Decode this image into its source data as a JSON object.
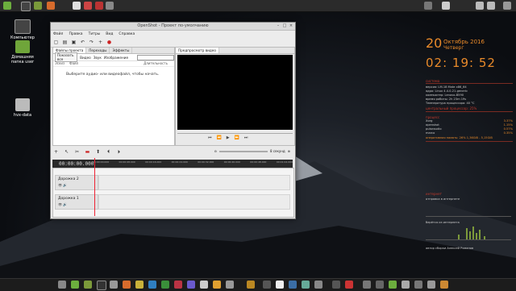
{
  "desktop": {
    "icons": [
      {
        "label": "Компьютер"
      },
      {
        "label": "Домашняя папка user"
      },
      {
        "label": "hvx-data"
      }
    ]
  },
  "window": {
    "title": "OpenShot - Проект по-умолчанию",
    "menu": [
      "Файл",
      "Правка",
      "Титры",
      "Вид",
      "Справка"
    ],
    "left_tabs": [
      "Файлы проекта",
      "Переходы",
      "Эффекты"
    ],
    "right_tabs": [
      "Предпросмотр видео"
    ],
    "filters": [
      "Показать все",
      "Видео",
      "Звук",
      "Изображение"
    ],
    "columns": [
      "Эскиз",
      "Файл",
      "Длительность"
    ],
    "hint": "Выберите аудио- или видеофайл, чтобы начать.",
    "zoom_label": "8 секунд",
    "timecode": "00:00:00.000",
    "tracks": [
      {
        "name": "Дорожка 2"
      },
      {
        "name": "Дорожка 1"
      }
    ],
    "ruler": [
      "00:00:00.000",
      "00:00:08.000",
      "00:00:16.000",
      "00:00:24.000",
      "00:00:32.000",
      "00:00:40.000",
      "00:00:48.000",
      "00:01:04.000"
    ]
  },
  "conky": {
    "day": "20",
    "month": "Октябрь 2016",
    "weekday": "Четверг",
    "time": "02: 19: 52",
    "section_system": "система",
    "system_lines": [
      "версия: LM-18 Mate x86_64",
      "ядро: Linux 4.4.0-21-generic",
      "компьютер: Lenovo-B590",
      "время работы: 2h 23m 19s",
      "Температура процессора: 40 °C"
    ],
    "section_cpu": "центральный процессор: 25%",
    "section_proc": "процесс",
    "proc_lines": [
      {
        "name": "Xorg",
        "val": "3.37%"
      },
      {
        "name": "openshot",
        "val": "1.15%"
      },
      {
        "name": "pulseaudio",
        "val": "0.57%"
      },
      {
        "name": "marco",
        "val": "0.35%"
      }
    ],
    "mem_line": "оперативная память: 26% 1,36GiB - 5,15GiB",
    "section_net": "интернет",
    "graph_label_down": "отправка в интернете",
    "graph_label_up": "берётся из интернета",
    "footer": "автор сборки Алексей Романов"
  }
}
